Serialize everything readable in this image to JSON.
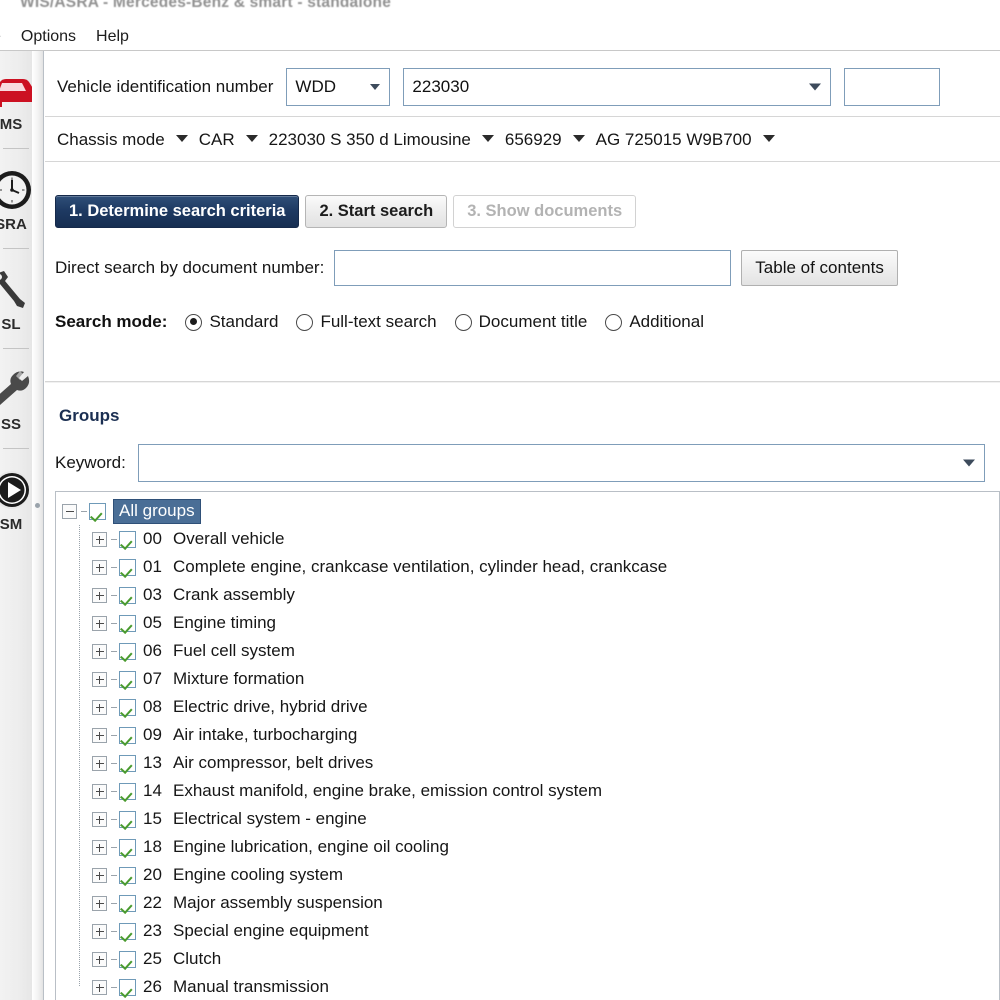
{
  "window": {
    "title": "WIS/ASRA - Mercedes-Benz & smart - standalone"
  },
  "menubar": {
    "items": [
      {
        "label": "e",
        "name": "menu-file-clipped"
      },
      {
        "label": "Options",
        "name": "menu-options"
      },
      {
        "label": "Help",
        "name": "menu-help"
      }
    ]
  },
  "rail": {
    "items": [
      {
        "label": "MS",
        "icon": "red-car-icon"
      },
      {
        "label": "SRA",
        "icon": "clock-icon"
      },
      {
        "label": "SL",
        "icon": "wrench-dark-icon"
      },
      {
        "label": "SS",
        "icon": "spanner-icon"
      },
      {
        "label": "SM",
        "icon": "play-circle-icon"
      }
    ]
  },
  "vin": {
    "label": "Vehicle identification number",
    "prefix_value": "WDD",
    "number_value": "223030",
    "extra_value": ""
  },
  "chassis": {
    "segments": [
      "Chassis mode",
      "CAR",
      "223030 S 350 d Limousine",
      "656929",
      "AG 725015 W9B700"
    ]
  },
  "tabs": [
    {
      "label": "1. Determine search criteria",
      "state": "active"
    },
    {
      "label": "2. Start search",
      "state": "normal"
    },
    {
      "label": "3. Show documents",
      "state": "disabled"
    }
  ],
  "direct_search": {
    "label": "Direct search by document number:",
    "value": "",
    "button_label": "Table of contents"
  },
  "search_mode": {
    "label": "Search mode:",
    "options": [
      {
        "label": "Standard",
        "selected": true
      },
      {
        "label": "Full-text search",
        "selected": false
      },
      {
        "label": "Document title",
        "selected": false
      },
      {
        "label": "Additional",
        "selected": false
      }
    ]
  },
  "groups": {
    "title": "Groups",
    "keyword_label": "Keyword:",
    "keyword_value": "",
    "root": {
      "label": "All groups",
      "checked": true,
      "expanded": true,
      "selected": true
    },
    "items": [
      {
        "num": "00",
        "label": "Overall vehicle",
        "checked": true
      },
      {
        "num": "01",
        "label": "Complete engine, crankcase ventilation, cylinder head, crankcase",
        "checked": true
      },
      {
        "num": "03",
        "label": "Crank assembly",
        "checked": true
      },
      {
        "num": "05",
        "label": "Engine timing",
        "checked": true
      },
      {
        "num": "06",
        "label": "Fuel cell system",
        "checked": true
      },
      {
        "num": "07",
        "label": "Mixture formation",
        "checked": true
      },
      {
        "num": "08",
        "label": "Electric drive, hybrid drive",
        "checked": true
      },
      {
        "num": "09",
        "label": "Air intake, turbocharging",
        "checked": true
      },
      {
        "num": "13",
        "label": "Air compressor, belt drives",
        "checked": true
      },
      {
        "num": "14",
        "label": "Exhaust manifold, engine brake, emission control system",
        "checked": true
      },
      {
        "num": "15",
        "label": "Electrical system - engine",
        "checked": true
      },
      {
        "num": "18",
        "label": "Engine lubrication, engine oil cooling",
        "checked": true
      },
      {
        "num": "20",
        "label": "Engine cooling system",
        "checked": true
      },
      {
        "num": "22",
        "label": "Major assembly suspension",
        "checked": true
      },
      {
        "num": "23",
        "label": "Special engine equipment",
        "checked": true
      },
      {
        "num": "25",
        "label": "Clutch",
        "checked": true
      },
      {
        "num": "26",
        "label": "Manual transmission",
        "checked": true
      }
    ]
  },
  "colors": {
    "tab_active": "#1e3a63",
    "selection": "#4a6e96",
    "field_border": "#7f9db9",
    "check_green": "#4a9b2f",
    "car_red": "#cc1122",
    "groups_title": "#1b2f52"
  }
}
